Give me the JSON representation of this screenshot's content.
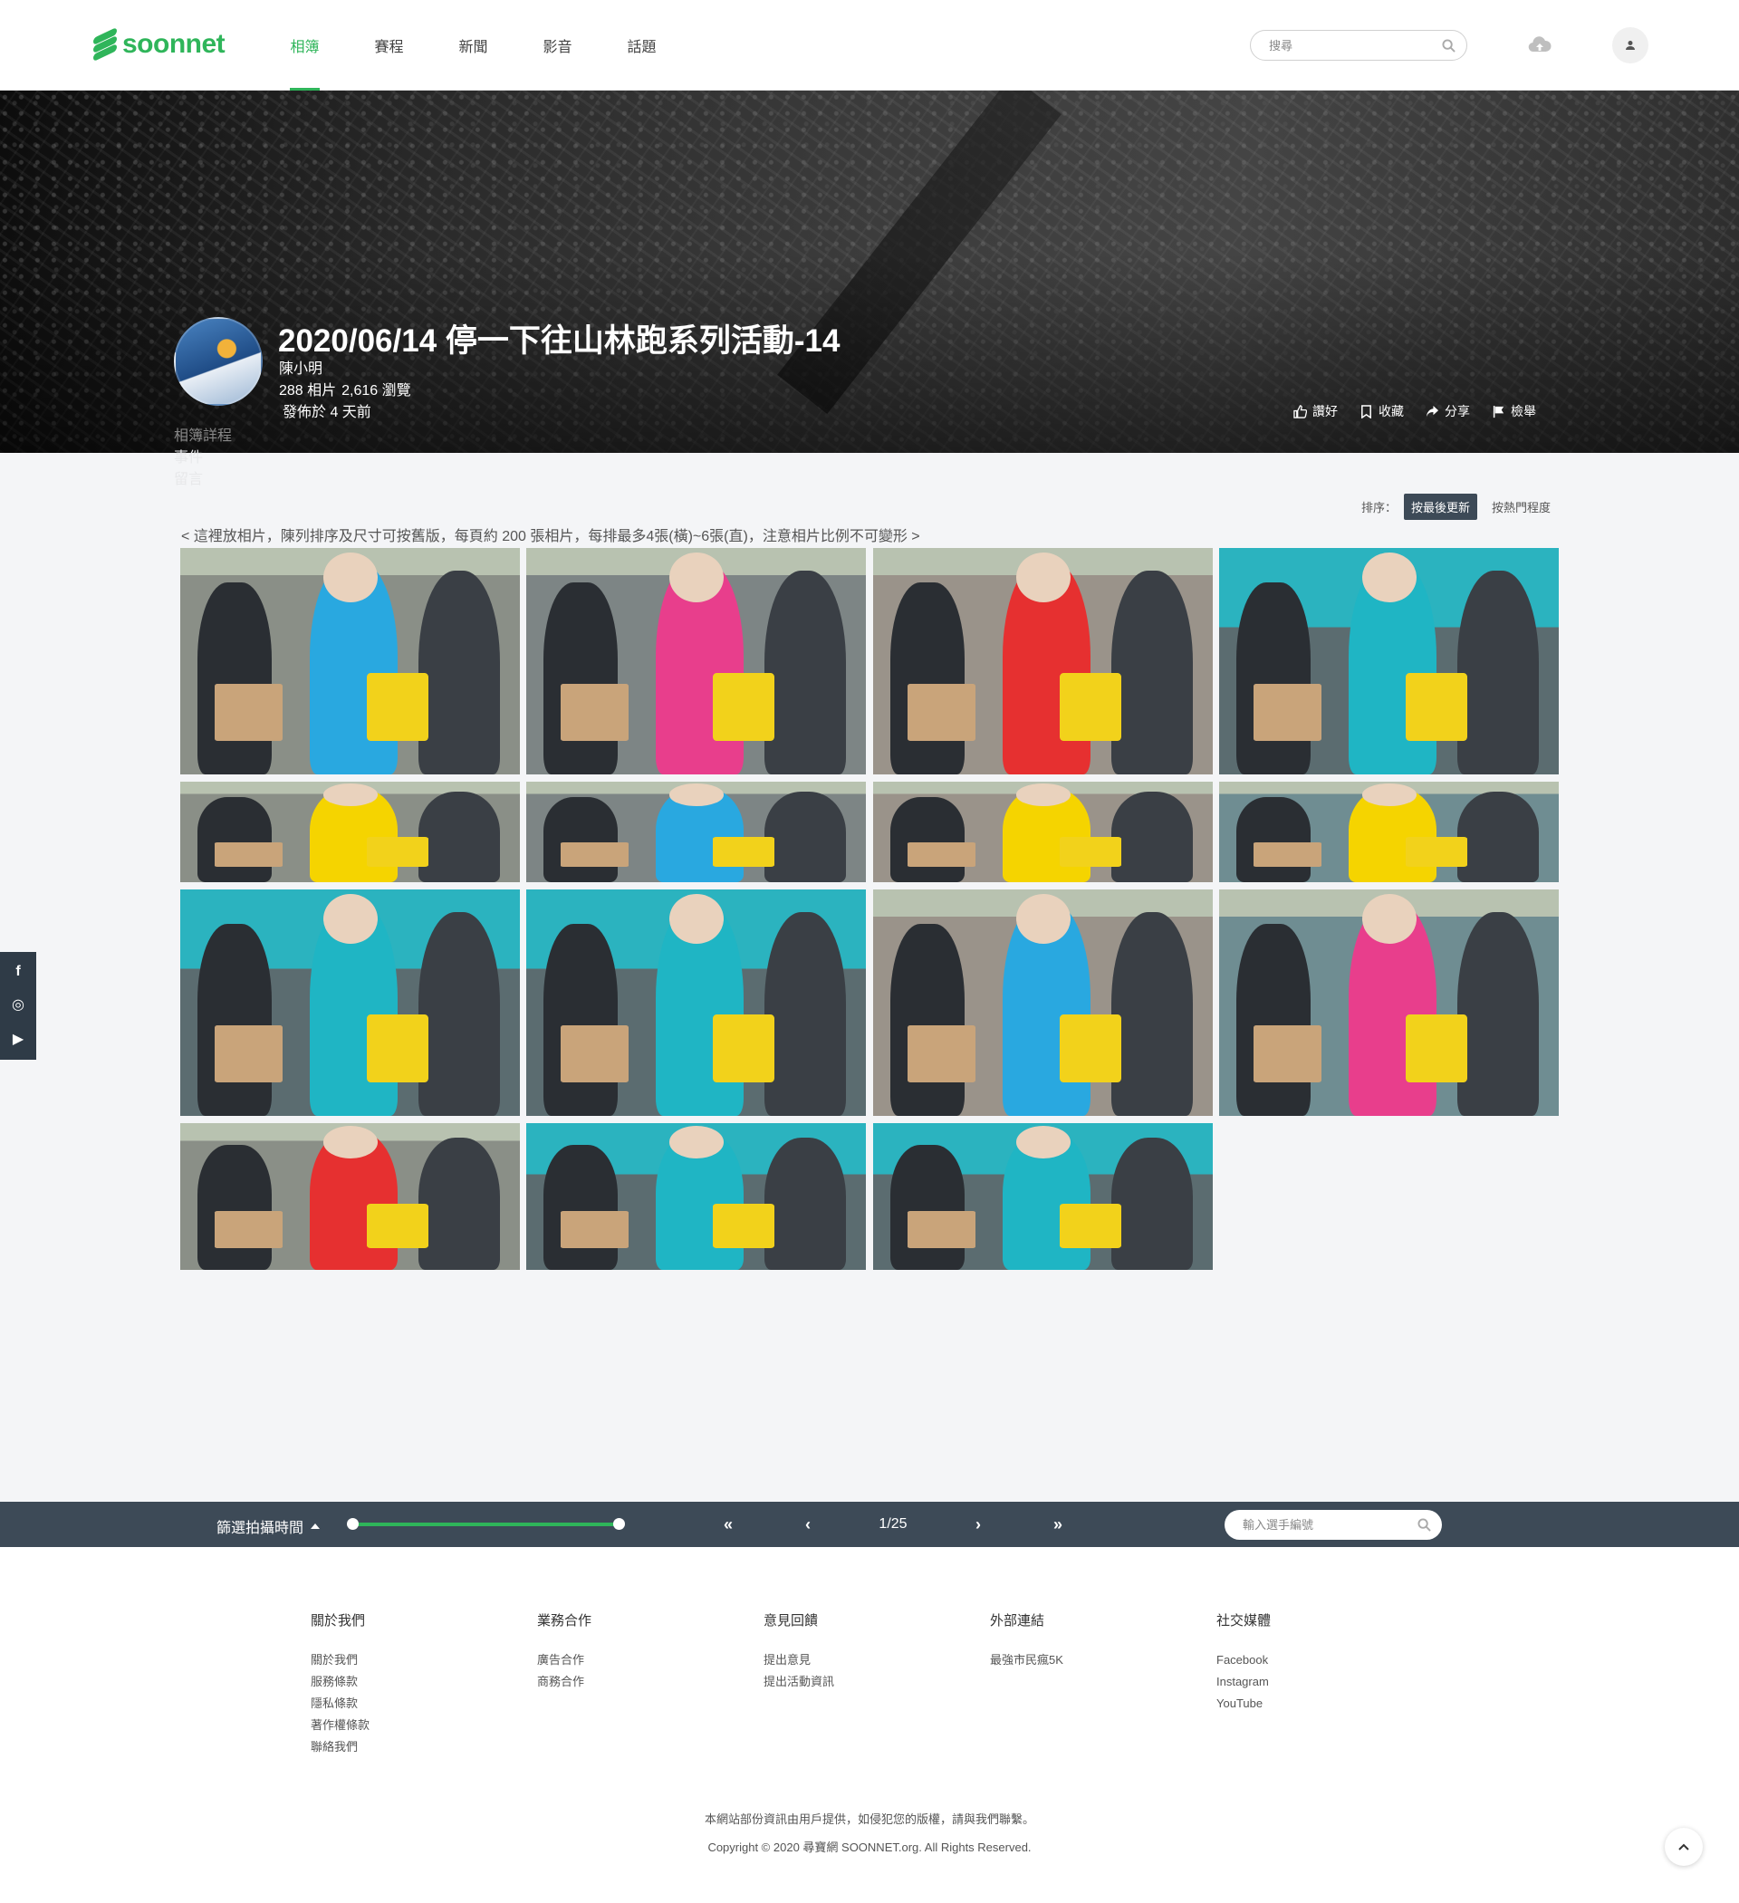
{
  "header": {
    "logo_text": "soonnet",
    "nav": [
      "相簿",
      "賽程",
      "新聞",
      "影音",
      "話題"
    ],
    "active_nav": 0,
    "search_placeholder": "搜尋"
  },
  "album": {
    "title": "2020/06/14 停一下往山林跑系列活動-14",
    "author": "陳小明",
    "photos": "288 相片",
    "views": "2,616 瀏覽",
    "published": "發佈於 4 天前",
    "actions": [
      {
        "icon": "thumbs-up-icon",
        "label": "讚好"
      },
      {
        "icon": "bookmark-icon",
        "label": "收藏"
      },
      {
        "icon": "share-icon",
        "label": "分享"
      },
      {
        "icon": "flag-icon",
        "label": "檢舉"
      }
    ],
    "tabs": [
      "相簿詳程",
      "事件",
      "留言"
    ]
  },
  "sort": {
    "label": "排序：",
    "options": [
      "按最後更新",
      "按熱門程度"
    ],
    "active": 0
  },
  "note": "< 這裡放相片，陳列排序及尺寸可按舊版，每頁約 200 張相片，每排最多4張(橫)~6張(直)，注意相片比例不可變形 >",
  "photos": [
    {
      "scene": "blue-shirts-checkin",
      "accent": "#29a8e0"
    },
    {
      "scene": "pink-shirt-phone",
      "accent": "#e83e8c"
    },
    {
      "scene": "red-shirt-crowd",
      "accent": "#e63030"
    },
    {
      "scene": "teal-container-table",
      "accent": "#1fb5c4"
    },
    {
      "scene": "yellow-bags-table",
      "accent": "#f5d400"
    },
    {
      "scene": "phone-closeup",
      "accent": "#29a8e0"
    },
    {
      "scene": "yellow-bag-closeup",
      "accent": "#f5d400"
    },
    {
      "scene": "legs-yellow-bags",
      "accent": "#f5d400"
    },
    {
      "scene": "teal-container-volunteers",
      "accent": "#1fb5c4"
    },
    {
      "scene": "teal-container-group",
      "accent": "#1fb5c4"
    },
    {
      "scene": "blue-shirts-checkin-2",
      "accent": "#29a8e0"
    },
    {
      "scene": "pink-shirt-phone-2",
      "accent": "#e83e8c"
    },
    {
      "scene": "red-shirt-crowd-2",
      "accent": "#e63030"
    },
    {
      "scene": "teal-container-table-2",
      "accent": "#1fb5c4"
    },
    {
      "scene": "teal-container-group-2",
      "accent": "#1fb5c4"
    }
  ],
  "social": [
    "f",
    "◎",
    "▶"
  ],
  "bar": {
    "filter_label": "篩選拍攝時間",
    "first": "«",
    "prev": "‹",
    "page": "1/25",
    "next": "›",
    "last": "»",
    "bib_placeholder": "輸入選手編號"
  },
  "footer": {
    "columns": [
      {
        "title": "關於我們",
        "links": [
          "關於我們",
          "服務條款",
          "隱私條款",
          "著作權條款",
          "聯絡我們"
        ]
      },
      {
        "title": "業務合作",
        "links": [
          "廣告合作",
          "商務合作"
        ]
      },
      {
        "title": "意見回饋",
        "links": [
          "提出意見",
          "提出活動資訊"
        ]
      },
      {
        "title": "外部連結",
        "links": [
          "最強市民瘋5K"
        ]
      },
      {
        "title": "社交媒體",
        "links": [
          "Facebook",
          "Instagram",
          "YouTube"
        ]
      }
    ],
    "disclaimer": "本網站部份資訊由用戶提供，如侵犯您的版權，請與我們聯繫。",
    "copyright": "Copyright © 2020 尋寶網 SOONNET.org. All Rights Reserved."
  }
}
